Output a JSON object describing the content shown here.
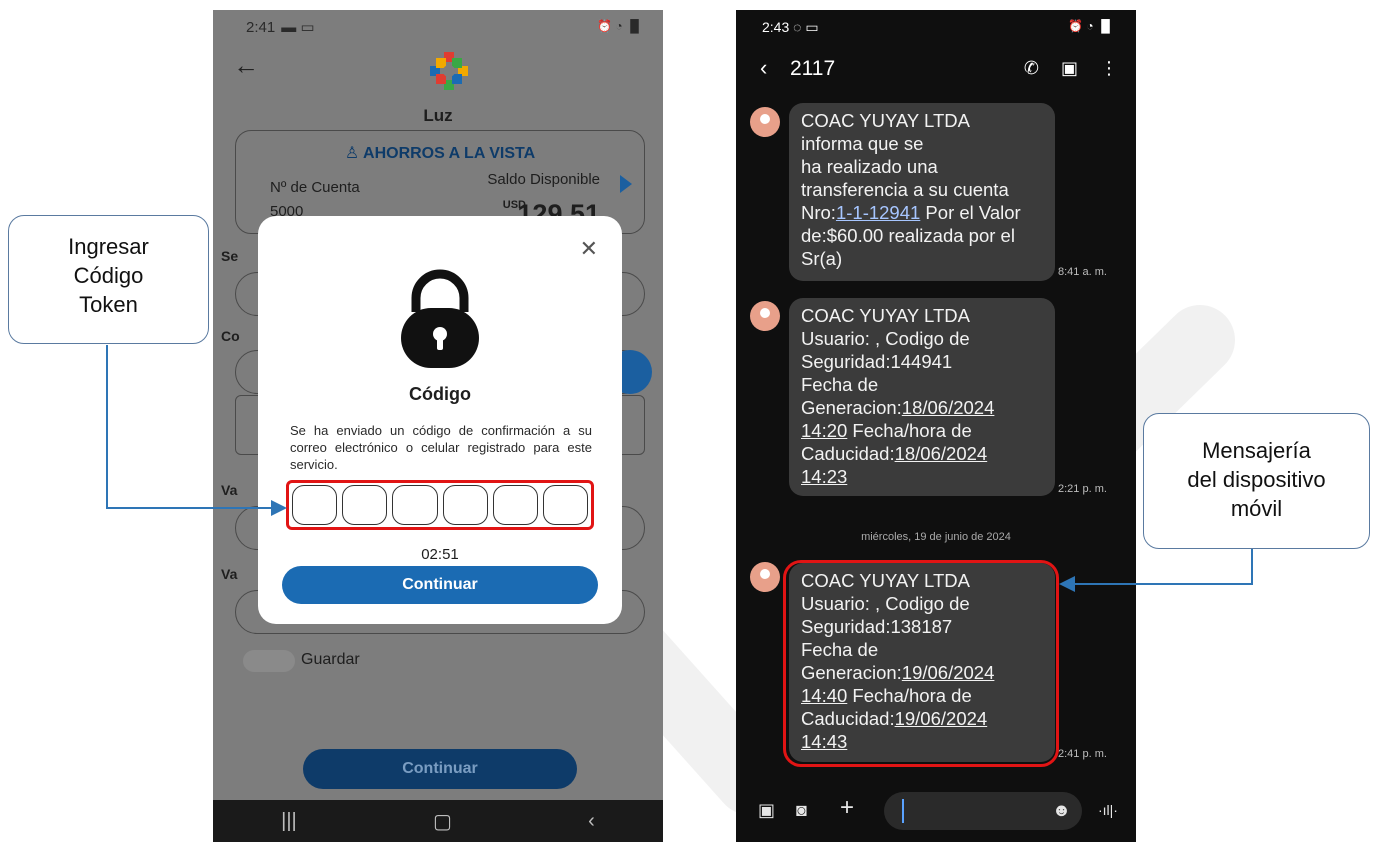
{
  "callouts": {
    "left": [
      "Ingresar",
      "Código",
      "Token"
    ],
    "right": [
      "Mensajería",
      "del dispositivo",
      "móvil"
    ]
  },
  "left_phone": {
    "status_time": "2:41",
    "back_icon": "arrow-left-icon",
    "user_name": "Luz",
    "account": {
      "title": "AHORROS A LA VISTA",
      "number_label": "Nº de Cuenta",
      "number_value": "5000",
      "balance_label": "Saldo Disponible",
      "currency": "USD",
      "balance": "129.51"
    },
    "modal": {
      "title": "Código",
      "message": "Se ha enviado un código de confirmación a su correo electrónico o celular registrado para este servicio.",
      "code_boxes": [
        "",
        "",
        "",
        "",
        "",
        ""
      ],
      "timer": "02:51",
      "continue_label": "Continuar"
    },
    "guardar_label": "Guardar",
    "continue_label": "Continuar"
  },
  "right_phone": {
    "status_time": "2:43",
    "contact": "2117",
    "messages": [
      {
        "lines": [
          "COAC YUYAY LTDA",
          "informa que se",
          "ha realizado una",
          "transferencia a su cuenta"
        ],
        "nro_prefix": "Nro:",
        "nro_link": "1-1-12941",
        "nro_suffix": " Por el Valor",
        "tail": [
          "de:$60.00 realizada por el",
          "Sr(a)"
        ],
        "time": "8:41 a. m."
      },
      {
        "lines": [
          "COAC YUYAY LTDA",
          "Usuario: , Codigo de",
          "Seguridad:144941",
          "Fecha de"
        ],
        "gen_prefix": "Generacion:",
        "gen_date": "18/06/2024",
        "gen_time": "14:20",
        "cad_mid": " Fecha/hora de",
        "cad_prefix": "Caducidad:",
        "cad_date": "18/06/2024",
        "cad_time": "14:23",
        "time": "2:21 p. m."
      },
      {
        "lines": [
          "COAC YUYAY LTDA",
          "Usuario: , Codigo de",
          "Seguridad:138187",
          "Fecha de"
        ],
        "gen_prefix": "Generacion:",
        "gen_date": "19/06/2024",
        "gen_time": "14:40",
        "cad_mid": " Fecha/hora de",
        "cad_prefix": "Caducidad:",
        "cad_date": "19/06/2024",
        "cad_time": "14:43",
        "time": "2:41 p. m."
      }
    ],
    "date_separator": "miércoles, 19 de junio de 2024"
  },
  "colors": {
    "highlight": "#e11414",
    "connector": "#2e75b6",
    "modal_button": "#1b6bb3"
  }
}
